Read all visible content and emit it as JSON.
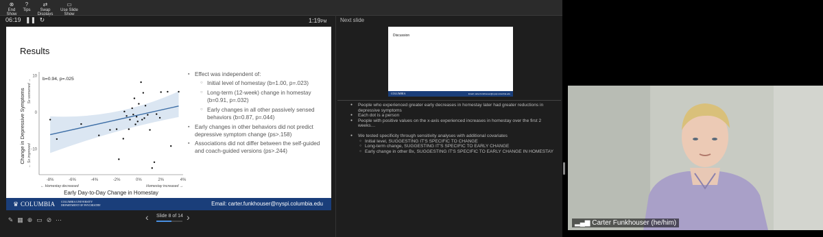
{
  "toolbar": {
    "items": [
      {
        "label": "End Show",
        "icon": "close-circle-icon"
      },
      {
        "label": "Tips",
        "icon": "question-circle-icon"
      },
      {
        "label": "Swap Displays",
        "icon": "swap-icon"
      },
      {
        "label": "Use Slide Show",
        "icon": "monitor-icon"
      }
    ]
  },
  "presenter": {
    "elapsed": "06:19",
    "clock_time": "1:19",
    "clock_ampm": "PM",
    "next_slide_label": "Next slide",
    "slide_count": "Slide 8 of 14",
    "progress": 0.57
  },
  "slide": {
    "title": "Results",
    "annotation": "b=0.94, p=.025",
    "y_axis_label": "Change in Depressive Symptoms",
    "y_top_label": "Sx worsened",
    "y_bottom_label": "Sx improved",
    "x_axis_label": "Early Day-to-Day Change in Homestay",
    "x_left_label": "← Homestay decreased",
    "x_right_label": "Homestay increased →",
    "footer_logo": "COLUMBIA",
    "footer_sub_1": "COLUMBIA UNIVERSITY",
    "footer_sub_2": "DEPARTMENT OF PSYCHIATRY",
    "footer_email": "Email: carter.funkhouser@nyspi.columbia.edu",
    "bullets": [
      {
        "level": 1,
        "text": "Effect was independent of:"
      },
      {
        "level": 2,
        "text": "Initial level of homestay (b=1.00, p=.023)"
      },
      {
        "level": 2,
        "text": "Long-term (12-week) change in homestay (b=0.91, p=.032)"
      },
      {
        "level": 2,
        "text": "Early changes in all other passively sensed behaviors (b=0.87, p=.044)"
      },
      {
        "level": 1,
        "text": "Early changes in other behaviors did not predict depressive symptom change (ps>.158)"
      },
      {
        "level": 1,
        "text": "Associations did not differ between the self-guided and coach-guided versions (ps>.244)"
      }
    ]
  },
  "chart_data": {
    "type": "scatter",
    "title": "",
    "xlabel": "Early Day-to-Day Change in Homestay",
    "ylabel": "Change in Depressive Symptoms",
    "xlim": [
      -9,
      4
    ],
    "ylim": [
      -17,
      11
    ],
    "x_ticks": [
      "-8%",
      "-6%",
      "-4%",
      "-2%",
      "0%",
      "2%",
      "4%"
    ],
    "y_ticks": [
      "10",
      "0",
      "-10"
    ],
    "points": [
      [
        -8,
        -2
      ],
      [
        -7.4,
        -7.3
      ],
      [
        -5.2,
        -3.2
      ],
      [
        -3.6,
        -6.3
      ],
      [
        -2.6,
        -4.8
      ],
      [
        -2,
        -4.6
      ],
      [
        -1.8,
        -12.8
      ],
      [
        -1.4,
        -7.2
      ],
      [
        -1.3,
        0.2
      ],
      [
        -1.1,
        -1
      ],
      [
        -0.9,
        -4.6
      ],
      [
        -0.8,
        -2
      ],
      [
        -0.6,
        1.1
      ],
      [
        -0.5,
        -0.6
      ],
      [
        -0.4,
        3.8
      ],
      [
        -0.3,
        -3.3
      ],
      [
        -0.2,
        -1.2
      ],
      [
        -0.1,
        -2.5
      ],
      [
        0,
        2.3
      ],
      [
        0.2,
        8.2
      ],
      [
        0.3,
        -2
      ],
      [
        0.4,
        5.3
      ],
      [
        0.5,
        -1.6
      ],
      [
        0.6,
        1.8
      ],
      [
        0.8,
        -0.7
      ],
      [
        1,
        -4.8
      ],
      [
        1.2,
        -15.2
      ],
      [
        1.4,
        -13.6
      ],
      [
        1.6,
        -0.5
      ],
      [
        1.9,
        -1.5
      ],
      [
        2,
        5.5
      ],
      [
        2.6,
        5.6
      ],
      [
        2.9,
        -9.2
      ],
      [
        3.6,
        5.6
      ]
    ],
    "fit": {
      "x": [
        -8,
        3.6
      ],
      "y": [
        -6.1,
        1.7
      ]
    },
    "grid": false,
    "legend": "none"
  },
  "next_slide": {
    "title": "Discussion",
    "footer_logo": "COLUMBIA",
    "footer_email": "Email: carter.funkhouser@nyspi.columbia.edu"
  },
  "notes": [
    {
      "level": 1,
      "text": "People who experienced greater early decreases in homestay later had greater reductions in depressive symptoms"
    },
    {
      "level": 1,
      "text": "Each dot is a person"
    },
    {
      "level": 1,
      "text": "People with positive values on the x-axis experienced increases in homestay over the first 2 weeks…"
    },
    {
      "level": 0,
      "text": ""
    },
    {
      "level": 1,
      "text": "We tested specificity through sensitivity analyses with additional covariates"
    },
    {
      "level": 2,
      "text": "Initial level, SUGGESTING IT'S SPECIFIC TO CHANGE"
    },
    {
      "level": 2,
      "text": "Long-term change, SUGGESTING IT'S SPECIFIC TO EARLY CHANGE"
    },
    {
      "level": 2,
      "text": "Early change in other Bx, SUGGESTING IT'S SPECIFIC TO EARLY CHANGE IN HOMESTAY"
    }
  ],
  "webcam": {
    "participant_name": "Carter Funkhouser (he/him)",
    "signal_icon": "signal-bars-icon"
  },
  "slide_tools": [
    "pen-icon",
    "grid-icon",
    "zoom-icon",
    "subtitles-icon",
    "camera-off-icon",
    "more-icon"
  ],
  "colors": {
    "footer_blue": "#1a3e7a",
    "fit_line": "#3d6ea6",
    "confidence_band": "#dbe6f2",
    "progress_fill": "#4a90e2"
  }
}
